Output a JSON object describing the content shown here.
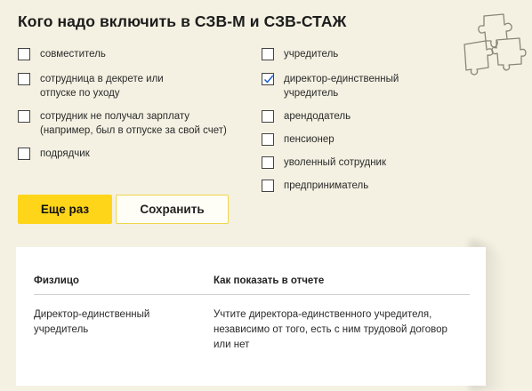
{
  "title": "Кого надо включить в СЗВ-М и СЗВ-СТАЖ",
  "options_left": [
    {
      "label_lines": [
        "совместитель"
      ],
      "checked": false
    },
    {
      "label_lines": [
        "сотрудница в декрете или",
        "отпуске по уходу"
      ],
      "checked": false
    },
    {
      "label_lines": [
        "сотрудник не получал зарплату",
        "(например, был в отпуске за свой счет)"
      ],
      "checked": false
    },
    {
      "label_lines": [
        "подрядчик"
      ],
      "checked": false
    }
  ],
  "options_right": [
    {
      "label_lines": [
        "учредитель"
      ],
      "checked": false
    },
    {
      "label_lines": [
        "директор-единственный",
        "учредитель"
      ],
      "checked": true
    },
    {
      "label_lines": [
        "арендодатель"
      ],
      "checked": false
    },
    {
      "label_lines": [
        "пенсионер"
      ],
      "checked": false
    },
    {
      "label_lines": [
        "уволенный сотрудник"
      ],
      "checked": false
    },
    {
      "label_lines": [
        "предприниматель"
      ],
      "checked": false
    }
  ],
  "buttons": {
    "again_label": "Еще раз",
    "save_label": "Сохранить"
  },
  "table": {
    "headers": [
      "Физлицо",
      "Как показать в отчете"
    ],
    "rows": [
      {
        "person_lines": [
          "Директор-единственный",
          "учредитель"
        ],
        "how_lines": [
          "Учтите директора-единственного учредителя,",
          "независимо от того, есть с ним трудовой договор",
          "или нет"
        ]
      }
    ]
  },
  "colors": {
    "background": "#f4f1e2",
    "accent_yellow": "#ffd51a",
    "check_blue": "#1f5fd6"
  },
  "icons": {
    "decoration": "puzzle-icon",
    "check": "checkmark-icon"
  }
}
